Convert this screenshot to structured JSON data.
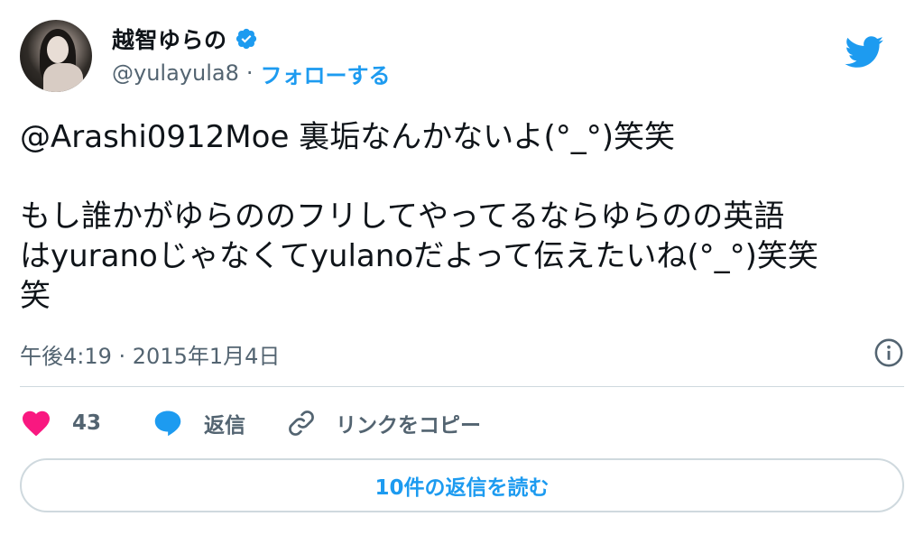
{
  "author": {
    "display_name": "越智ゆらの",
    "handle": "@yulayula8",
    "separator": "·",
    "follow_label": "フォローする",
    "verified": true
  },
  "tweet": {
    "line1": "@Arashi0912Moe 裏垢なんかないよ(°_°)笑笑",
    "line2": "もし誰かがゆらののフリしてやってるならゆらのの英語\nはyuranoじゃなくてyulanoだよって伝えたいね(°_°)笑笑\n笑"
  },
  "meta": {
    "timestamp": "午後4:19 · 2015年1月4日"
  },
  "actions": {
    "like_count": "43",
    "reply_label": "返信",
    "copy_link_label": "リンクをコピー"
  },
  "read_replies_label": "10件の返信を読む",
  "icons": {
    "verified": "verified-badge-icon",
    "bird": "twitter-bird-icon",
    "info": "info-icon",
    "like": "heart-icon",
    "reply": "speech-bubble-icon",
    "link": "link-icon"
  },
  "colors": {
    "accent": "#1d9bf0",
    "like": "#f91880",
    "text": "#0f1419",
    "muted": "#536471",
    "border": "#cfd9de"
  }
}
